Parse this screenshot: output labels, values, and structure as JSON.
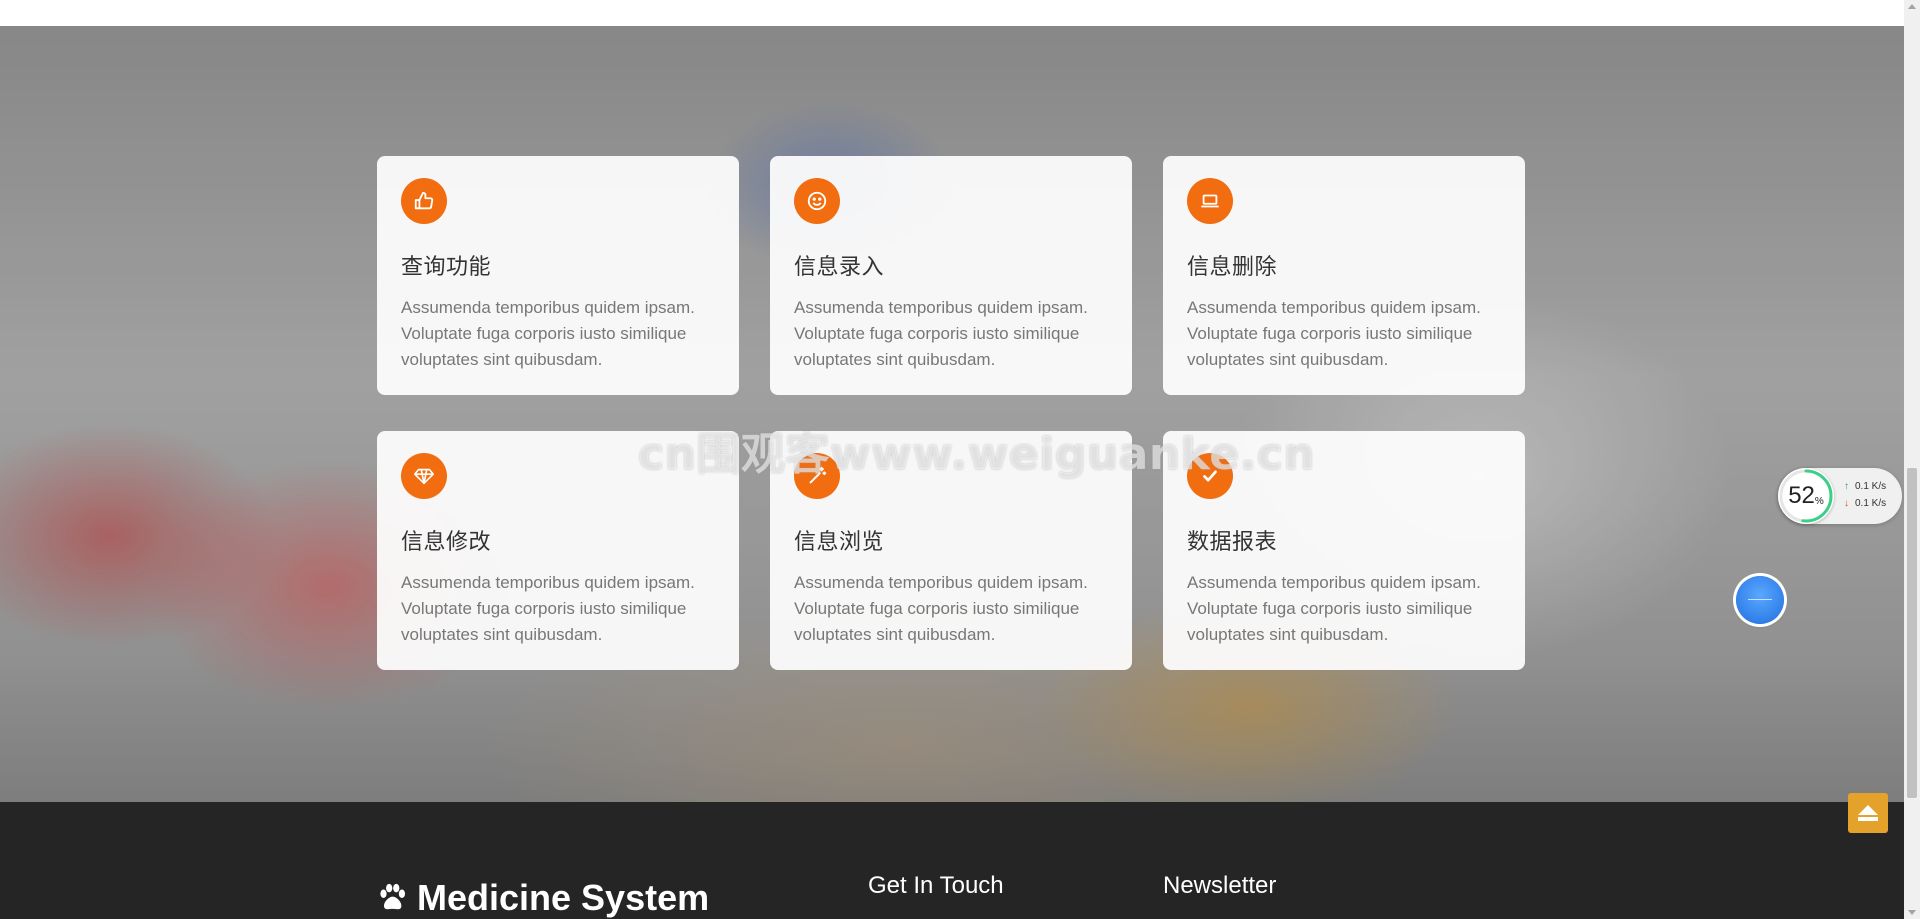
{
  "features": [
    {
      "icon": "thumbs-up-icon",
      "title": "查询功能",
      "description": "Assumenda temporibus quidem ipsam. Voluptate fuga corporis iusto similique voluptates sint quibusdam."
    },
    {
      "icon": "smile-icon",
      "title": "信息录入",
      "description": "Assumenda temporibus quidem ipsam. Voluptate fuga corporis iusto similique voluptates sint quibusdam."
    },
    {
      "icon": "laptop-icon",
      "title": "信息删除",
      "description": "Assumenda temporibus quidem ipsam. Voluptate fuga corporis iusto similique voluptates sint quibusdam."
    },
    {
      "icon": "diamond-icon",
      "title": "信息修改",
      "description": "Assumenda temporibus quidem ipsam. Voluptate fuga corporis iusto similique voluptates sint quibusdam."
    },
    {
      "icon": "magic-wand-icon",
      "title": "信息浏览",
      "description": "Assumenda temporibus quidem ipsam. Voluptate fuga corporis iusto similique voluptates sint quibusdam."
    },
    {
      "icon": "check-circle-icon",
      "title": "数据报表",
      "description": "Assumenda temporibus quidem ipsam. Voluptate fuga corporis iusto similique voluptates sint quibusdam."
    }
  ],
  "watermark": "cn围观客www.weiguanke.cn",
  "footer": {
    "brand": "Medicine System",
    "brand_icon": "paw-icon",
    "contact_heading": "Get In Touch",
    "newsletter_heading": "Newsletter"
  },
  "speed_widget": {
    "percent": "52",
    "percent_unit": "%",
    "upload": "0.1 K/s",
    "download": "0.1 K/s"
  },
  "colors": {
    "accent": "#f26d10",
    "footer_bg": "#252525",
    "back_to_top": "#e5a22b"
  }
}
